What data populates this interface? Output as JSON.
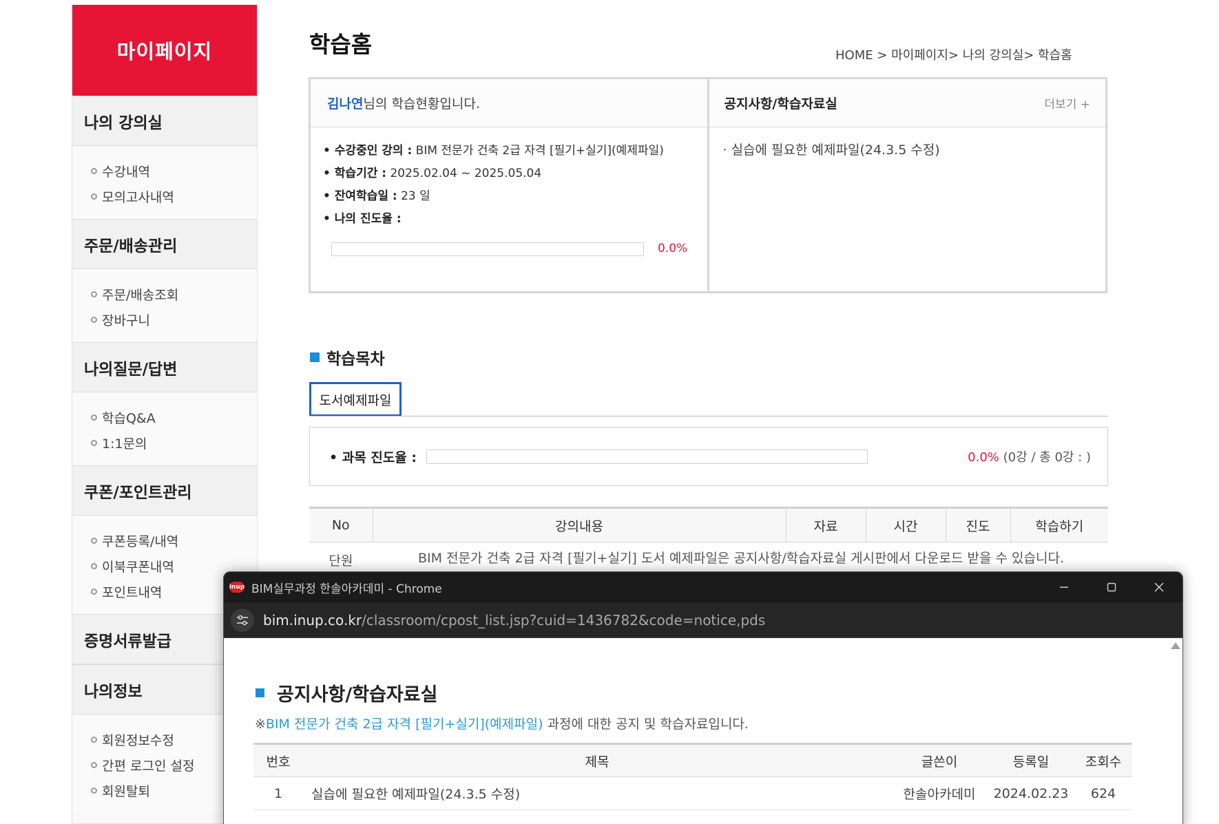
{
  "sidebar": {
    "header": "마이페이지",
    "groups": [
      {
        "title": "나의 강의실",
        "items": [
          "수강내역",
          "모의고사내역"
        ]
      },
      {
        "title": "주문/배송관리",
        "items": [
          "주문/배송조회",
          "장바구니"
        ]
      },
      {
        "title": "나의질문/답변",
        "items": [
          "학습Q&A",
          "1:1문의"
        ]
      },
      {
        "title": "쿠폰/포인트관리",
        "items": [
          "쿠폰등록/내역",
          "이북쿠폰내역",
          "포인트내역"
        ]
      },
      {
        "title": "증명서류발급",
        "items": []
      },
      {
        "title": "나의정보",
        "items": [
          "회원정보수정",
          "간편 로그인 설정",
          "회원탈퇴"
        ]
      }
    ]
  },
  "page": {
    "title": "학습홈",
    "breadcrumb": "HOME > 마이페이지> 나의 강의실> 학습홈"
  },
  "status": {
    "user_name": "김나연",
    "user_suffix": "님의 학습현황입니다.",
    "course_label": "• 수강중인 강의 :",
    "course_value": "BIM 전문가 건축 2급 자격 [필기+실기](예제파일)",
    "period_label": "• 학습기간 :",
    "period_value": "2025.02.04 ~ 2025.05.04",
    "remaining_label": "• 잔여학습일 :",
    "remaining_value": "23 일",
    "progress_label": "• 나의 진도율 :",
    "progress_fraction": 0.0,
    "progress_text": "0.0%"
  },
  "notice_panel": {
    "title": "공지사항/학습자료실",
    "more": "더보기 +",
    "items": [
      "· 실습에 필요한 예제파일(24.3.5 수정)"
    ]
  },
  "toc": {
    "title": "학습목차",
    "tab": "도서예제파일",
    "subject_label": "• 과목 진도율 :",
    "subject_fraction": 0.0,
    "subject_pct": "0.0%",
    "subject_count": "(0강 / 총 0강 : )"
  },
  "lecture_table": {
    "headers": [
      "No",
      "강의내용",
      "자료",
      "시간",
      "진도",
      "학습하기"
    ],
    "rows": [
      {
        "no": "단원",
        "content": "BIM 전문가 건축 2급 자격 [필기+실기] 도서 예제파일은 공지사항/학습자료실 게시판에서 다운로드 받을 수 있습니다."
      }
    ]
  },
  "popup": {
    "window_title": "BIM실무과정 한솔아카데미 - Chrome",
    "app_icon": "inup",
    "url_host": "bim.inup.co.kr",
    "url_path": "/classroom/cpost_list.jsp?cuid=1436782&code=notice,pds",
    "title": "공지사항/학습자료실",
    "desc_prefix": "※",
    "desc_course": "BIM 전문가 건축 2급 자격 [필기+실기](예제파일)",
    "desc_suffix": " 과정에 대한 공지 및 학습자료입니다.",
    "table": {
      "headers": [
        "번호",
        "제목",
        "글쓴이",
        "등록일",
        "조회수"
      ],
      "rows": [
        {
          "no": "1",
          "title": "실습에 필요한 예제파일(24.3.5 수정)",
          "author": "한솔아카데미",
          "date": "2024.02.23",
          "views": "624"
        }
      ]
    }
  },
  "colors": {
    "accent_red": "#e61535",
    "accent_blue": "#1a8fd8",
    "link_blue": "#1f62c8"
  }
}
